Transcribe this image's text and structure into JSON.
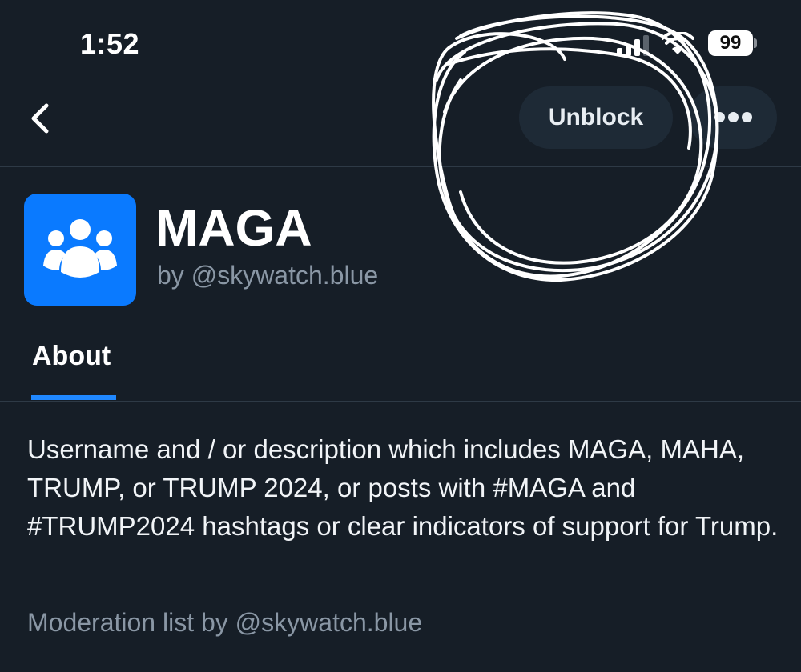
{
  "status_bar": {
    "time": "1:52",
    "battery_level": "99"
  },
  "header": {
    "back_icon": "chevron-left-icon",
    "unblock_label": "Unblock",
    "more_icon": "ellipsis-icon"
  },
  "list": {
    "avatar_icon": "people-group-icon",
    "avatar_color": "#0a7aff",
    "title": "MAGA",
    "byline": "by @skywatch.blue"
  },
  "tabs": [
    {
      "label": "About",
      "selected": true
    }
  ],
  "about": {
    "description": "Username and / or description which includes MAGA, MAHA, TRUMP, or TRUMP 2024, or posts with #MAGA and #TRUMP2024 hashtags or clear indicators of support for Trump.",
    "credit": "Moderation list by @skywatch.blue"
  },
  "colors": {
    "background": "#161e27",
    "accent": "#2088ff",
    "muted_text": "#8a97a5",
    "button_bg": "#1e2a36"
  }
}
